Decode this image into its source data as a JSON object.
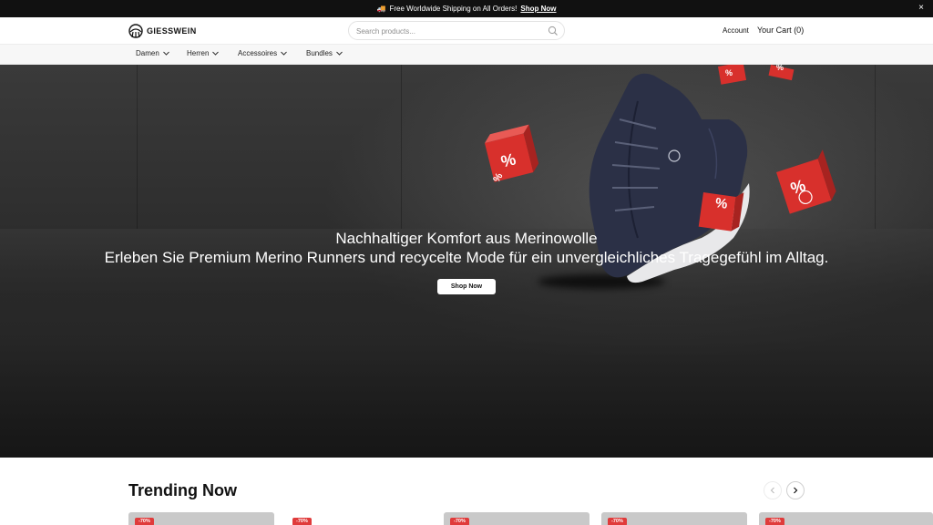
{
  "announcement": {
    "icon": "truck-icon",
    "text": "Free Worldwide Shipping on All Orders!",
    "link": "Shop Now",
    "close": "×"
  },
  "header": {
    "logo_text": "GIESSWEIN",
    "search_placeholder": "Search products...",
    "account": "Account",
    "cart": "Your Cart (0)"
  },
  "nav": {
    "items": [
      {
        "label": "Damen"
      },
      {
        "label": "Herren"
      },
      {
        "label": "Accessoires"
      },
      {
        "label": "Bundles"
      }
    ]
  },
  "hero": {
    "title": "Nachhaltiger Komfort aus Merinowolle",
    "subtitle": "Erleben Sie Premium Merino Runners und recycelte Mode für ein unvergleichliches Tragegefühl im Alltag.",
    "button": "Shop Now",
    "dice_symbol": "%"
  },
  "trending": {
    "title": "Trending Now",
    "cards": [
      {
        "badge": "-70%"
      },
      {
        "badge": "-70%"
      },
      {
        "badge": "-70%"
      },
      {
        "badge": "-70%"
      },
      {
        "badge": "-70%"
      }
    ]
  },
  "colors": {
    "announcement_bg": "#111111",
    "badge_red": "#e03b3b",
    "dice_red": "#d8302c",
    "shoe_navy": "#2b3046",
    "sole_white": "#e8e8ea"
  }
}
